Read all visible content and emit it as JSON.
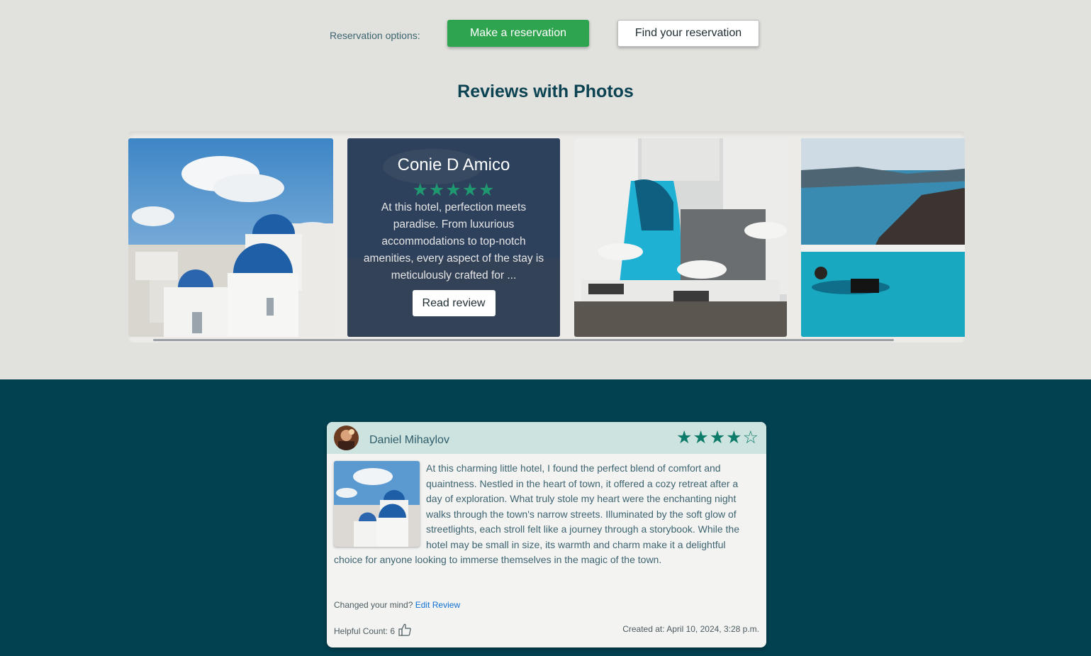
{
  "reservation": {
    "label": "Reservation options:",
    "make_label": "Make a reservation",
    "find_label": "Find your reservation"
  },
  "photos_section": {
    "title": "Reviews with Photos",
    "featured_review": {
      "name": "Conie D Amico",
      "stars": "★★★★★",
      "rating": 5,
      "excerpt": "At this hotel, perfection meets paradise. From luxurious accommodations to top-notch amenities, every aspect of the stay is meticulously crafted for ...",
      "button_label": "Read review"
    }
  },
  "review": {
    "reviewer": "Daniel Mihaylov",
    "stars": "★★★★☆",
    "rating": 4,
    "text": "At this charming little hotel, I found the perfect blend of comfort and quaintness. Nestled in the heart of town, it offered a cozy retreat after a day of exploration. What truly stole my heart were the enchanting night walks through the town's narrow streets. Illuminated by the soft glow of streetlights, each stroll felt like a journey through a storybook. While the hotel may be small in size, its warmth and charm make it a delightful choice for anyone looking to immerse themselves in the magic of the town.",
    "changed_mind": "Changed your mind?",
    "edit_label": "Edit Review",
    "helpful_label": "Helpful Count: 6",
    "created_label": "Created at: April 10, 2024, 3:28 p.m."
  },
  "colors": {
    "accent_green": "#2ea44f",
    "star_green": "#0e7c6b",
    "dark_teal": "#014150",
    "title_teal": "#0b4352"
  },
  "icons": [
    "star-icon",
    "thumbs-up-icon"
  ]
}
